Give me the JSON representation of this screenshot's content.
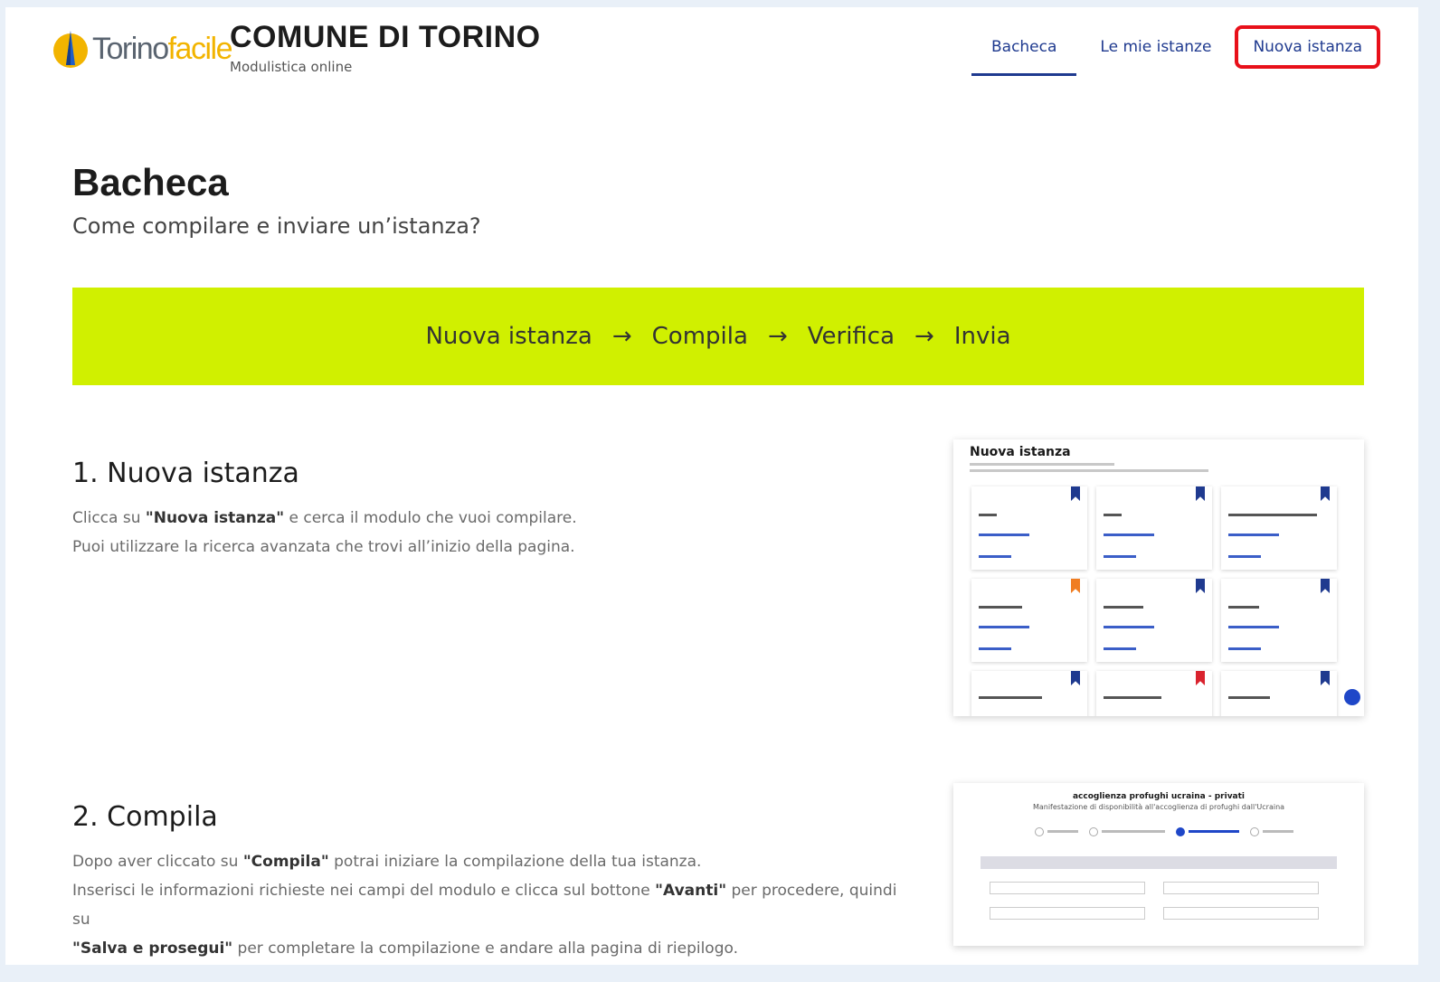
{
  "header": {
    "logo": {
      "text_a": "Torino",
      "text_b": "facile"
    },
    "title": "COMUNE DI TORINO",
    "subtitle": "Modulistica online"
  },
  "nav": [
    {
      "label": "Bacheca",
      "active": true
    },
    {
      "label": "Le mie istanze",
      "active": false
    },
    {
      "label": "Nuova istanza",
      "active": false,
      "highlighted": true
    }
  ],
  "page": {
    "title": "Bacheca",
    "subtitle": "Come compilare e inviare un’istanza?"
  },
  "banner": {
    "steps": [
      "Nuova istanza",
      "Compila",
      "Verifica",
      "Invia"
    ],
    "arrow": "→",
    "color": "#d0f000"
  },
  "sections": [
    {
      "title": "1. Nuova istanza",
      "lines": [
        {
          "pre": "Clicca su ",
          "bold": "\"Nuova istanza\"",
          "post": " e cerca il modulo che vuoi compilare."
        },
        {
          "pre": "Puoi utilizzare la ricerca avanzata che trovi all’inizio della pagina.",
          "bold": "",
          "post": ""
        }
      ],
      "thumbnail_title": "Nuova istanza"
    },
    {
      "title": "2. Compila",
      "lines": [
        {
          "pre": "Dopo aver cliccato su ",
          "bold": "\"Compila\"",
          "post": " potrai iniziare la compilazione della tua istanza."
        },
        {
          "pre": "Inserisci le informazioni richieste nei campi del modulo e clicca sul bottone ",
          "bold": "\"Avanti\"",
          "post": " per procedere, quindi su"
        },
        {
          "pre": "",
          "bold": "\"Salva e prosegui\"",
          "post": " per completare la compilazione e andare alla pagina di riepilogo."
        }
      ],
      "thumbnail_title": "accoglienza profughi ucraina - privati",
      "thumbnail_subtitle": "Manifestazione di disponibilità all'accoglienza di profughi dall'Ucraina"
    }
  ],
  "colors": {
    "accent": "#1f3a8f",
    "highlight_box": "#e8101a",
    "banner": "#d0f000"
  }
}
